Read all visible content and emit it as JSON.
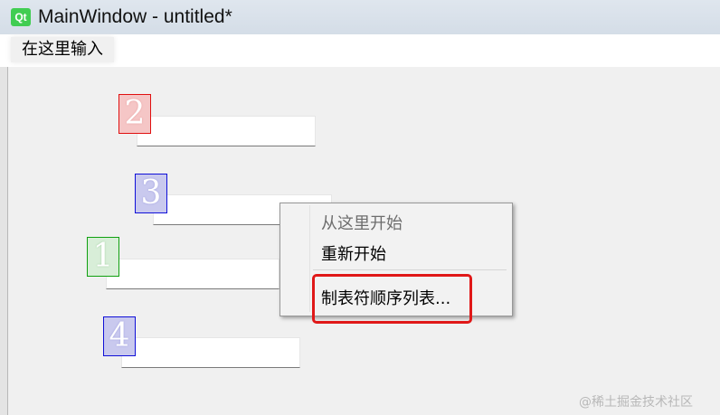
{
  "window": {
    "logo": "Qt",
    "title": "MainWindow - untitled*"
  },
  "menubar": {
    "placeholder_item": "在这里输入"
  },
  "tab_order_badges": [
    "2",
    "3",
    "1",
    "4"
  ],
  "context_menu": {
    "items": [
      {
        "label": "从这里开始",
        "enabled": false
      },
      {
        "label": "重新开始",
        "enabled": true
      },
      {
        "label": "制表符顺序列表...",
        "enabled": true
      }
    ]
  },
  "watermark": "@稀土掘金技术社区",
  "colors": {
    "badge_red": "#e01010",
    "badge_blue": "#1010d8",
    "badge_green": "#10a010",
    "highlight": "#e01818",
    "qt_green": "#41cd52"
  }
}
